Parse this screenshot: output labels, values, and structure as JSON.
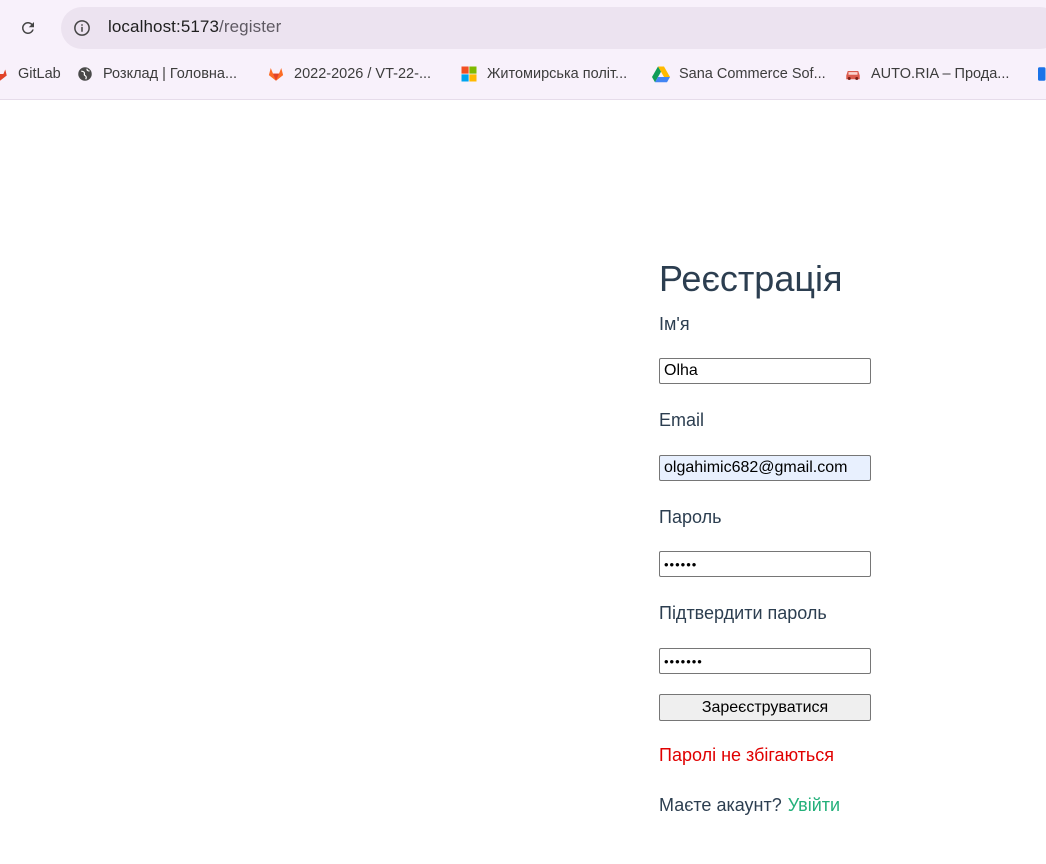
{
  "browser": {
    "url_host": "localhost:5173",
    "url_path": "/register",
    "bookmarks": [
      {
        "label": "GitLab",
        "icon": "gitlab-icon"
      },
      {
        "label": "Розклад | Головна...",
        "icon": "globe-icon"
      },
      {
        "label": "2022-2026 / VT-22-...",
        "icon": "gitlab-fox-icon"
      },
      {
        "label": "Житомирська політ...",
        "icon": "windows-icon"
      },
      {
        "label": "Sana Commerce Sof...",
        "icon": "google-drive-icon"
      },
      {
        "label": "AUTO.RIA – Прода...",
        "icon": "car-icon"
      }
    ]
  },
  "page": {
    "title": "Реєстрація",
    "name_label": "Ім'я",
    "name_value": "Olha",
    "email_label": "Email",
    "email_value": "olgahimic682@gmail.com",
    "password_label": "Пароль",
    "password_value": "••••••",
    "confirm_label": "Підтвердити пароль",
    "confirm_value": "•••••••",
    "submit_label": "Зареєструватися",
    "error_text": "Паролі не збігаються",
    "have_account_text": "Маєте акаунт?",
    "login_link": "Увійти"
  },
  "colors": {
    "text": "#2c3e50",
    "error": "#e00000",
    "link": "#23b07a",
    "autofill": "#e8f0fe"
  }
}
